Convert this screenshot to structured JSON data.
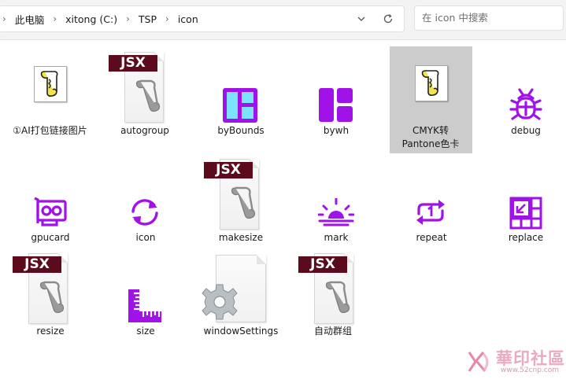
{
  "address_bar": {
    "crumbs": [
      "此电脑",
      "xitong (C:)",
      "TSP",
      "icon"
    ]
  },
  "search": {
    "placeholder": "在 icon 中搜索"
  },
  "files": [
    {
      "name": "①AI打包链接图片",
      "kind": "script-file"
    },
    {
      "name": "autogroup",
      "kind": "jsx-file"
    },
    {
      "name": "byBounds",
      "kind": "bounds-icon"
    },
    {
      "name": "bywh",
      "kind": "layout-icon"
    },
    {
      "name": "CMYK转Pantone色卡",
      "kind": "script-file",
      "selected": true
    },
    {
      "name": "debug",
      "kind": "bug-icon"
    },
    {
      "name": "gpucard",
      "kind": "gpu-card-icon"
    },
    {
      "name": "icon",
      "kind": "refresh-icon"
    },
    {
      "name": "makesize",
      "kind": "jsx-file"
    },
    {
      "name": "mark",
      "kind": "sunrise-icon"
    },
    {
      "name": "repeat",
      "kind": "repeat-one-icon"
    },
    {
      "name": "replace",
      "kind": "replace-grid-icon"
    },
    {
      "name": "resize",
      "kind": "jsx-file"
    },
    {
      "name": "size",
      "kind": "ruler-icon"
    },
    {
      "name": "windowSettings",
      "kind": "settings-page-icon"
    },
    {
      "name": "自动群组",
      "kind": "jsx-file"
    }
  ],
  "jsx_tag": "JSX",
  "watermark": {
    "text": "華印社區",
    "url": "www.52cnp.com"
  },
  "colors": {
    "accent": "#a112e8",
    "jsx_tag": "#5c0b1c",
    "selection": "#cccccc"
  }
}
